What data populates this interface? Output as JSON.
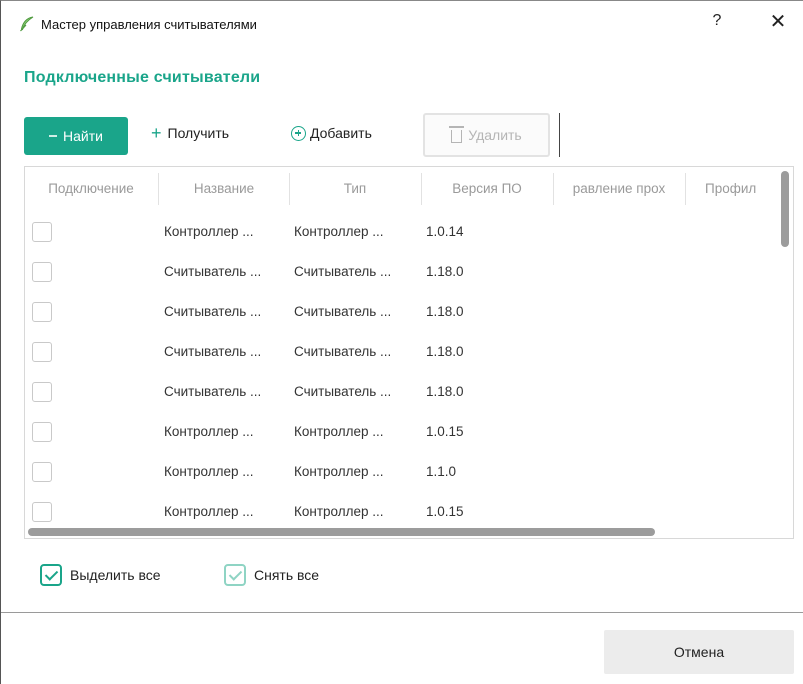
{
  "window": {
    "title": "Мастер управления считывателями",
    "help_label": "?",
    "close_label": "✕"
  },
  "section_title": "Подключенные считыватели",
  "toolbar": {
    "find_label": "Найти",
    "get_label": "Получить",
    "add_label": "Добавить",
    "delete_label": "Удалить",
    "delete_disabled": true
  },
  "table": {
    "columns": [
      "Подключение",
      "Название",
      "Тип",
      "Версия ПО",
      "равление прох",
      "Профил"
    ],
    "rows": [
      {
        "checked": false,
        "name": "Контроллер ...",
        "type": "Контроллер ...",
        "version": "1.0.14"
      },
      {
        "checked": false,
        "name": "Считыватель ...",
        "type": "Считыватель ...",
        "version": "1.18.0"
      },
      {
        "checked": false,
        "name": "Считыватель ...",
        "type": "Считыватель ...",
        "version": "1.18.0"
      },
      {
        "checked": false,
        "name": "Считыватель ...",
        "type": "Считыватель ...",
        "version": "1.18.0"
      },
      {
        "checked": false,
        "name": "Считыватель ...",
        "type": "Считыватель ...",
        "version": "1.18.0"
      },
      {
        "checked": false,
        "name": "Контроллер ...",
        "type": "Контроллер ...",
        "version": "1.0.15"
      },
      {
        "checked": false,
        "name": "Контроллер ...",
        "type": "Контроллер ...",
        "version": "1.1.0"
      },
      {
        "checked": false,
        "name": "Контроллер ...",
        "type": "Контроллер ...",
        "version": "1.0.15"
      }
    ]
  },
  "select_all_label": "Выделить все",
  "deselect_all_label": "Снять все",
  "cancel_label": "Отмена",
  "colors": {
    "accent": "#1aa58a",
    "disabled_text": "#b5b5b5",
    "header_text": "#9a9a9a"
  }
}
